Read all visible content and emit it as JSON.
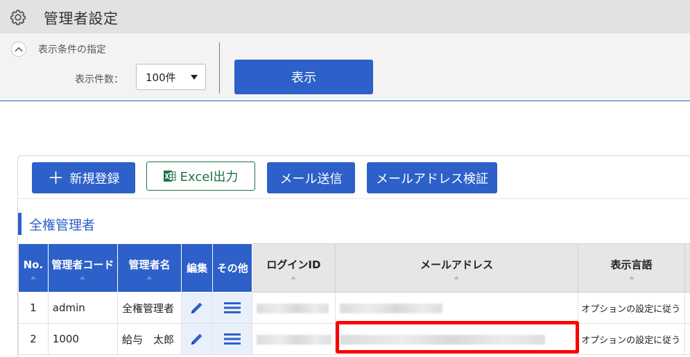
{
  "header": {
    "title": "管理者設定",
    "icon": "gear-icon"
  },
  "filter": {
    "heading": "表示条件の指定",
    "count_label": "表示件数：",
    "count_value": "100件",
    "show_button": "表示"
  },
  "toolbar": {
    "new_label": "新規登録",
    "excel_label": "Excel出力",
    "mail_label": "メール送信",
    "verify_label": "メールアドレス検証"
  },
  "section": {
    "title": "全権管理者"
  },
  "table": {
    "headers": {
      "no": "No.",
      "code": "管理者コード",
      "name": "管理者名",
      "edit": "編集",
      "other": "その他",
      "login": "ログインID",
      "email": "メールアドレス",
      "lang": "表示言語"
    },
    "rows": [
      {
        "no": "1",
        "code": "admin",
        "name": "全権管理者",
        "lang": "オプションの設定に従う"
      },
      {
        "no": "2",
        "code": "1000",
        "name": "給与　太郎",
        "lang": "オプションの設定に従う"
      }
    ]
  },
  "colors": {
    "accent": "#2d60c8",
    "excel": "#1f7145",
    "highlight": "#ff0000"
  }
}
